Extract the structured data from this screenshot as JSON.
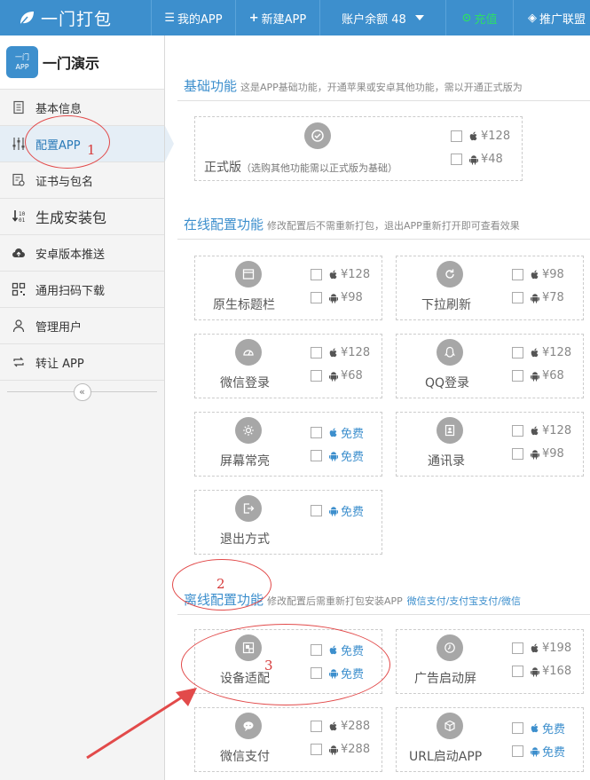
{
  "topbar": {
    "brand": "一门打包",
    "my_app": "我的APP",
    "new_app": "新建APP",
    "balance": "账户余额 48",
    "recharge": "充值",
    "promo": "推广联盟"
  },
  "app": {
    "icon_line1": "一门",
    "icon_line2": "APP",
    "name": "一门演示"
  },
  "sidebar": {
    "items": [
      {
        "label": "基本信息"
      },
      {
        "label": "配置APP"
      },
      {
        "label": "证书与包名"
      },
      {
        "label": "生成安装包"
      },
      {
        "label": "安卓版本推送"
      },
      {
        "label": "通用扫码下载"
      },
      {
        "label": "管理用户"
      },
      {
        "label": "转让 APP"
      }
    ],
    "collapse": "«"
  },
  "sections": {
    "basic": {
      "title": "基础功能",
      "desc": "这是APP基础功能，开通苹果或安卓其他功能，需以开通正式版为"
    },
    "online": {
      "title": "在线配置功能",
      "desc": "修改配置后不需重新打包，退出APP重新打开即可查看效果"
    },
    "offline": {
      "title": "离线配置功能",
      "desc": "修改配置后需重新打包安装APP",
      "links": "微信支付/支付宝支付/微信"
    }
  },
  "features": {
    "official": {
      "name": "正式版",
      "note": "（选购其他功能需以正式版为基础）",
      "ios": "¥128",
      "android": "¥48"
    },
    "titlebar": {
      "name": "原生标题栏",
      "ios": "¥128",
      "android": "¥98"
    },
    "pullrefresh": {
      "name": "下拉刷新",
      "ios": "¥98",
      "android": "¥78"
    },
    "wechatlogin": {
      "name": "微信登录",
      "ios": "¥128",
      "android": "¥68"
    },
    "qqlogin": {
      "name": "QQ登录",
      "ios": "¥128",
      "android": "¥68"
    },
    "screenon": {
      "name": "屏幕常亮",
      "ios": "免费",
      "android": "免费"
    },
    "contacts": {
      "name": "通讯录",
      "ios": "¥128",
      "android": "¥98"
    },
    "exit": {
      "name": "退出方式",
      "android": "免费"
    },
    "device": {
      "name": "设备适配",
      "ios": "免费",
      "android": "免费"
    },
    "splashad": {
      "name": "广告启动屏",
      "ios": "¥198",
      "android": "¥168"
    },
    "wechatpay": {
      "name": "微信支付",
      "ios": "¥288",
      "android": "¥288"
    },
    "urlstart": {
      "name": "URL启动APP",
      "ios": "免费",
      "android": "免费"
    }
  },
  "annotations": {
    "n1": "1",
    "n2": "2",
    "n3": "3"
  },
  "colors": {
    "primary": "#3d8fcd",
    "recharge": "#2ddc6a",
    "annotation": "#e24a4a",
    "icon_grey": "#a7a7a7"
  }
}
